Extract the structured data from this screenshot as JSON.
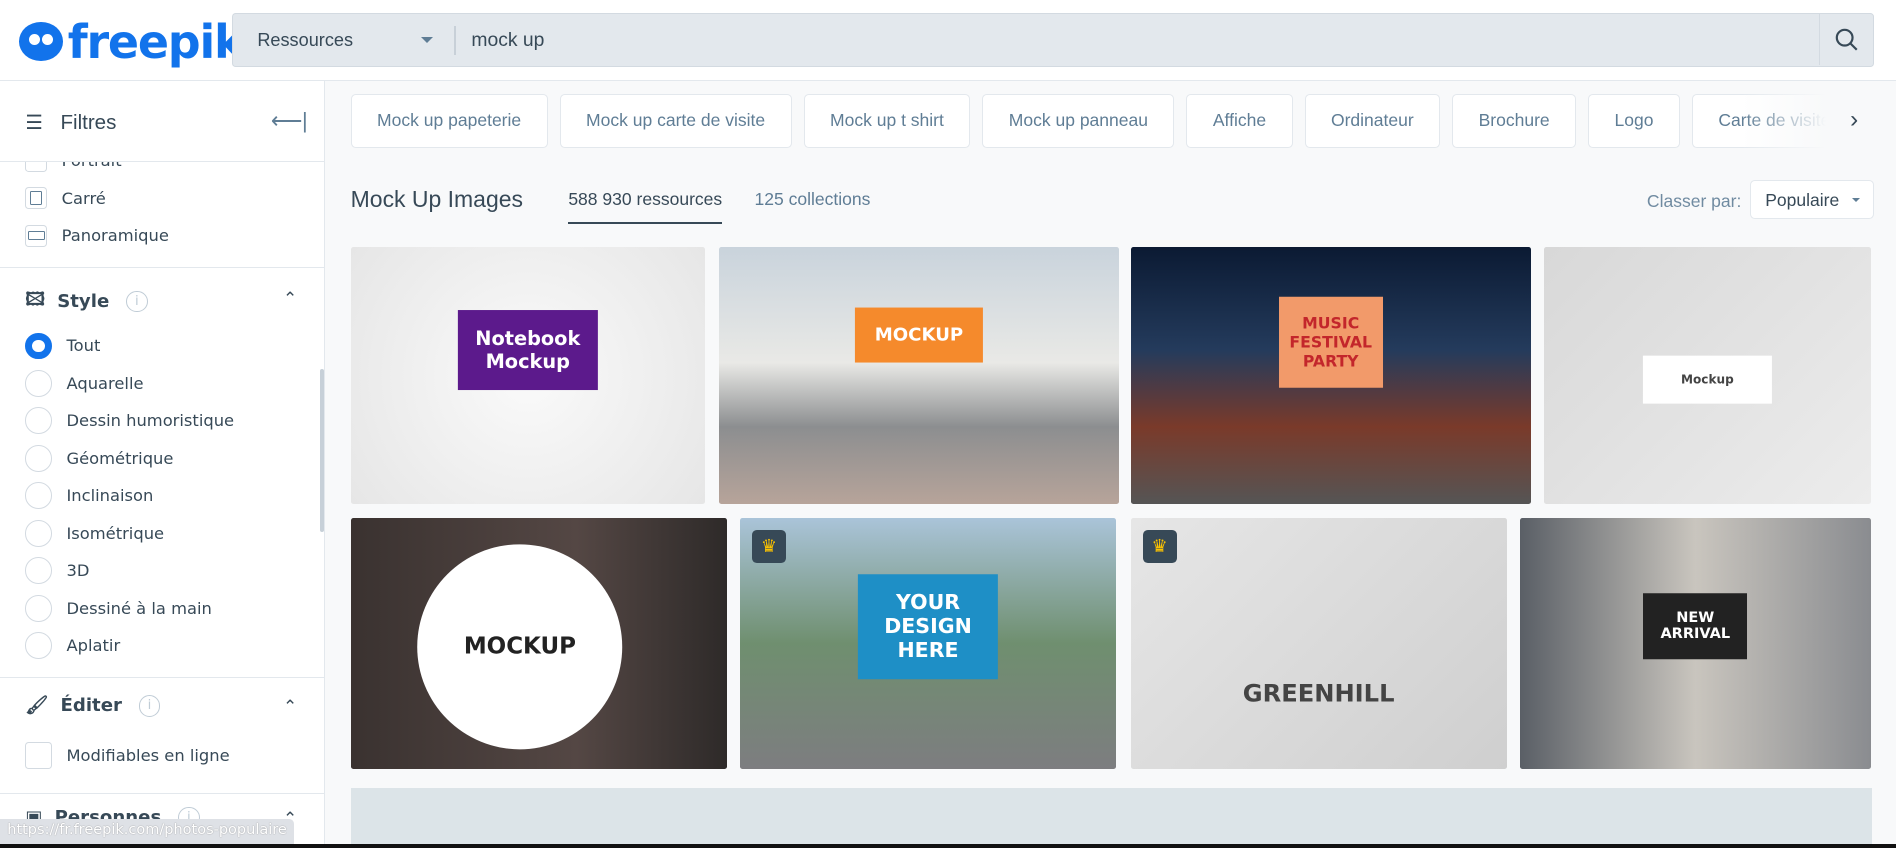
{
  "header": {
    "logo": "freepik",
    "search_type": "Ressources",
    "search_value": "mock up"
  },
  "sidebar": {
    "title": "Filtres",
    "orientation_items": [
      {
        "label": "Portrait"
      },
      {
        "label": "Carré"
      },
      {
        "label": "Panoramique"
      }
    ],
    "style": {
      "title": "Style",
      "selected": "Tout",
      "items": [
        {
          "label": "Tout"
        },
        {
          "label": "Aquarelle"
        },
        {
          "label": "Dessin humoristique"
        },
        {
          "label": "Géométrique"
        },
        {
          "label": "Inclinaison"
        },
        {
          "label": "Isométrique"
        },
        {
          "label": "3D"
        },
        {
          "label": "Dessiné à la main"
        },
        {
          "label": "Aplatir"
        }
      ]
    },
    "edit": {
      "title": "Éditer",
      "items": [
        {
          "label": "Modifiables en ligne"
        }
      ]
    },
    "people": {
      "title": "Personnes"
    }
  },
  "chips": [
    "Mock up papeterie",
    "Mock up carte de visite",
    "Mock up t shirt",
    "Mock up panneau",
    "Affiche",
    "Ordinateur",
    "Brochure",
    "Logo",
    "Carte de visite"
  ],
  "results": {
    "title": "Mock Up Images",
    "tab_resources": "588 930 ressources",
    "tab_collections": "125 collections",
    "sort_label": "Classer par:",
    "sort_value": "Populaire"
  },
  "images": [
    {
      "caption": "Notebook Mockup",
      "premium": false
    },
    {
      "caption": "MOCKUP",
      "premium": false
    },
    {
      "caption": "MUSIC FESTIVAL PARTY",
      "premium": false
    },
    {
      "caption": "Mockup",
      "premium": false
    },
    {
      "caption": "MOCKUP",
      "premium": false
    },
    {
      "caption": "YOUR DESIGN HERE",
      "premium": true
    },
    {
      "caption": "GREENHILL",
      "premium": true
    },
    {
      "caption": "NEW ARRIVAL",
      "premium": false
    }
  ],
  "status_url": "https://fr.freepik.com/photos-populaire",
  "colors": {
    "brand": "#1273eb",
    "text": "#374957",
    "crown": "#fcc300"
  }
}
